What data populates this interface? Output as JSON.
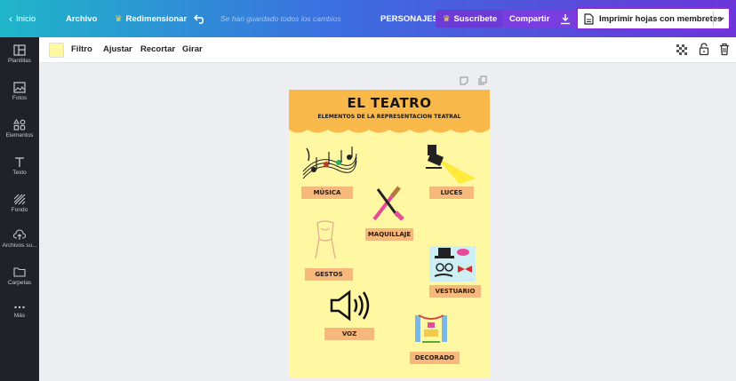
{
  "topbar": {
    "home": "Inicio",
    "file": "Archivo",
    "resize": "Redimensionar",
    "save_status": "Se han guardado todos los cambios",
    "project_name": "PERSONAJES",
    "subscribe": "Suscríbete",
    "share": "Compartir",
    "print": "Imprimir hojas con membretes"
  },
  "sidebar": {
    "items": [
      {
        "label": "Plantillas",
        "icon": "templates-icon"
      },
      {
        "label": "Fotos",
        "icon": "photos-icon"
      },
      {
        "label": "Elementos",
        "icon": "elements-icon"
      },
      {
        "label": "Texto",
        "icon": "text-icon"
      },
      {
        "label": "Fondo",
        "icon": "background-icon"
      },
      {
        "label": "Archivos su...",
        "icon": "uploads-icon"
      },
      {
        "label": "Carpetas",
        "icon": "folder-icon"
      },
      {
        "label": "Más",
        "icon": "more-icon"
      }
    ]
  },
  "toolbar": {
    "filter": "Filtro",
    "adjust": "Ajustar",
    "crop": "Recortar",
    "rotate": "Girar",
    "swatch_color": "#fff7a1"
  },
  "poster": {
    "title": "EL TEATRO",
    "subtitle": "ELEMENTOS DE LA REPRESENTACION TEATRAL",
    "labels": {
      "music": "MÚSICA",
      "lights": "LUCES",
      "makeup": "MAQUILLAJE",
      "gestures": "GESTOS",
      "costume": "VESTUARIO",
      "voice": "VOZ",
      "set": "DECORADO"
    },
    "colors": {
      "background": "#fff7a1",
      "banner": "#f9b84a",
      "label": "#f7b97b"
    }
  }
}
